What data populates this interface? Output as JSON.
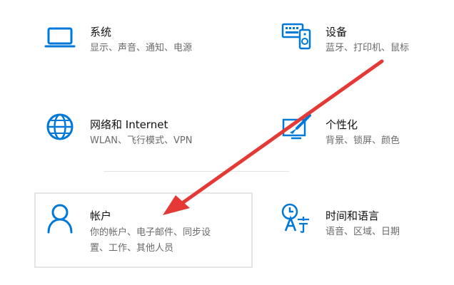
{
  "accent_color": "#0078d7",
  "annotation_color": "#e53935",
  "tiles": {
    "system": {
      "title": "系统",
      "subtitle": "显示、声音、通知、电源",
      "icon": "laptop-icon"
    },
    "devices": {
      "title": "设备",
      "subtitle": "蓝牙、打印机、鼠标",
      "icon": "keyboard-speaker-icon"
    },
    "network": {
      "title": "网络和 Internet",
      "subtitle": "WLAN、飞行模式、VPN",
      "icon": "globe-icon"
    },
    "personalization": {
      "title": "个性化",
      "subtitle": "背景、锁屏、颜色",
      "icon": "paint-brush-icon"
    },
    "accounts": {
      "title": "帐户",
      "subtitle_line1": "你的帐户、电子邮件、同步设",
      "subtitle_line2": "置、工作、其他人员",
      "icon": "person-icon"
    },
    "time_language": {
      "title": "时间和语言",
      "subtitle": "语音、区域、日期",
      "icon": "time-language-icon"
    }
  }
}
